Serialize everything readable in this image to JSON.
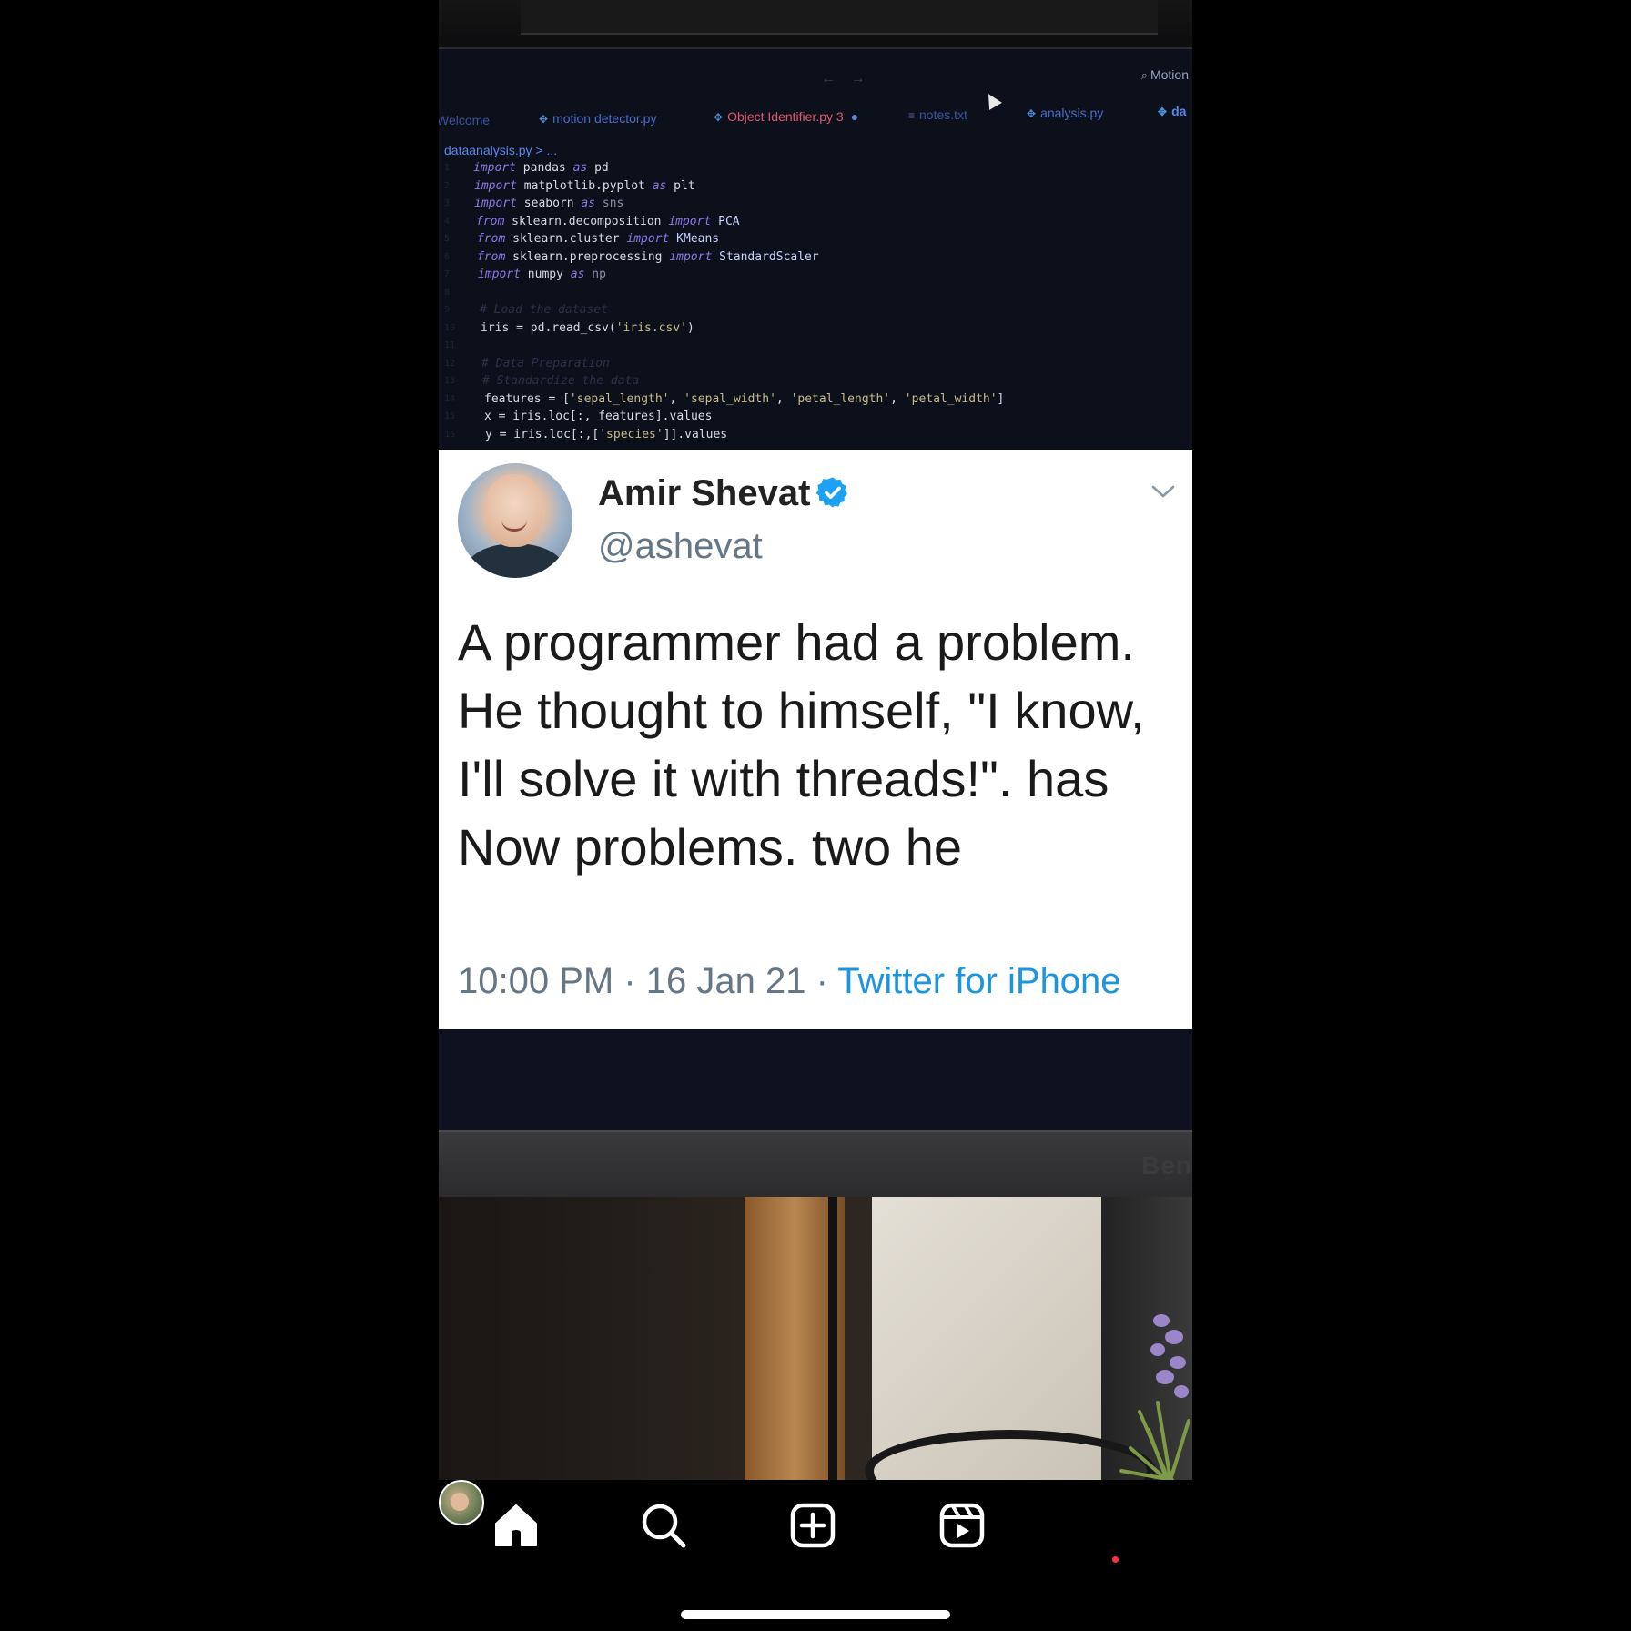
{
  "editor": {
    "search_label": "Motion",
    "nav_arrows": "← →",
    "tabs": [
      {
        "label": "Welcome"
      },
      {
        "label": "motion detector.py"
      },
      {
        "label": "Object Identifier.py",
        "badge": "3"
      },
      {
        "label": "notes.txt"
      },
      {
        "label": "analysis.py"
      },
      {
        "label": "da"
      }
    ],
    "breadcrumb": "dataanalysis.py > ...",
    "code_lines": {
      "l1": [
        "import",
        " pandas ",
        "as",
        " pd"
      ],
      "l2": [
        "import",
        " matplotlib.pyplot ",
        "as",
        " plt"
      ],
      "l3": [
        "import",
        " seaborn ",
        "as",
        " sns"
      ],
      "l4": [
        "from",
        " sklearn.decomposition ",
        "import",
        " PCA"
      ],
      "l5": [
        "from",
        " sklearn.cluster ",
        "import",
        " KMeans"
      ],
      "l6": [
        "from",
        " sklearn.preprocessing ",
        "import",
        " StandardScaler"
      ],
      "l7": [
        "import",
        " numpy ",
        "as",
        " np"
      ],
      "l9": "# Load the dataset",
      "l10": [
        "iris = pd.read_csv(",
        "'iris.csv'",
        ")"
      ],
      "l12": "# Data Preparation",
      "l13": "# Standardize the data",
      "l14": [
        "features = [",
        "'sepal_length'",
        ", ",
        "'sepal_width'",
        ", ",
        "'petal_length'",
        ", ",
        "'petal_width'",
        "]"
      ],
      "l15": "x = iris.loc[:, features].values",
      "l16": [
        "y = iris.loc[:,[",
        "'species'",
        "]].values"
      ]
    }
  },
  "tweet": {
    "author_name": "Amir Shevat",
    "author_handle": "@ashevat",
    "text": "A programmer had a problem. He thought to himself, \"I know, I'll solve it with threads!\". has Now problems. two he",
    "time": "10:00 PM · 16 Jan 21 · ",
    "source": "Twitter for iPhone",
    "colors": {
      "verified": "#1da1f2",
      "link": "#1b95e0",
      "meta": "#657786"
    }
  },
  "photo": {
    "brand_text": "Ben"
  },
  "bottom_nav": {
    "items": [
      {
        "name": "home",
        "icon": "home-icon"
      },
      {
        "name": "search",
        "icon": "search-icon"
      },
      {
        "name": "create",
        "icon": "plus-square-icon"
      },
      {
        "name": "reels",
        "icon": "reels-icon"
      },
      {
        "name": "profile",
        "icon": "avatar"
      }
    ],
    "notification_color": "#ff3040"
  }
}
